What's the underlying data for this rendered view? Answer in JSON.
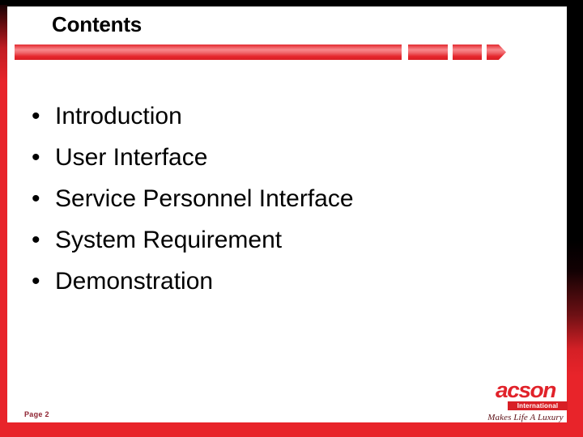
{
  "slide": {
    "title": "Contents",
    "page_label": "Page 2",
    "accent_color": "#e8242a",
    "border_color": "#000000",
    "page_label_color": "#8e2230"
  },
  "rule": {
    "segments": [
      "segment-main",
      "segment-two",
      "segment-three",
      "segment-arrow-tip"
    ]
  },
  "bullets": [
    {
      "marker": "•",
      "text": "Introduction"
    },
    {
      "marker": "•",
      "text": "User Interface"
    },
    {
      "marker": "•",
      "text": "Service Personnel Interface"
    },
    {
      "marker": "•",
      "text": "System Requirement"
    },
    {
      "marker": "•",
      "text": "Demonstration"
    }
  ],
  "logo": {
    "wordmark": "acson",
    "banner": "International",
    "tagline": "Makes Life A Luxury",
    "wordmark_color": "#e1222a",
    "banner_color": "#d81f25"
  }
}
